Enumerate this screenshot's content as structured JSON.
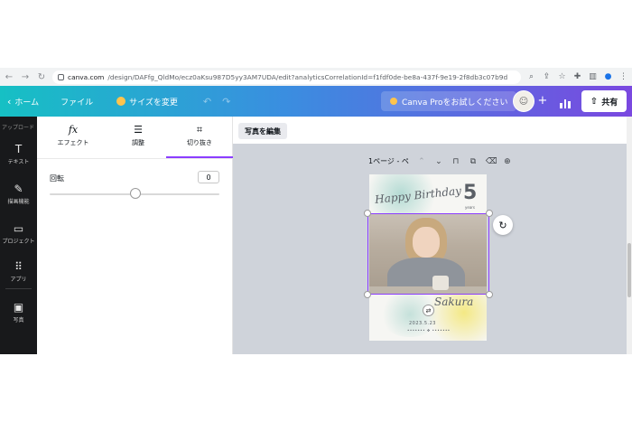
{
  "browser": {
    "url_host": "canva.com",
    "url_path": "/design/DAFfg_QldMo/ecz0aKsu987D5yy3AM7UDA/edit?analyticsCorrelationId=f1fdf0de-be8a-437f-9e19-2f8db3c07b9d"
  },
  "header": {
    "home_label": "ホーム",
    "file_label": "ファイル",
    "resize_label": "サイズを変更",
    "pro_label": "Canva Proをお試しください",
    "share_label": "共有"
  },
  "rail": {
    "top_label": "アップロード",
    "items": [
      {
        "label": "テキスト",
        "icon": "T"
      },
      {
        "label": "描画機能",
        "icon": "✎"
      },
      {
        "label": "プロジェクト",
        "icon": "▭"
      },
      {
        "label": "アプリ",
        "icon": "⠿"
      },
      {
        "label": "写真",
        "icon": "▣"
      }
    ]
  },
  "panel": {
    "tabs": [
      {
        "label": "エフェクト",
        "icon": "fx"
      },
      {
        "label": "調整",
        "icon": "☰"
      },
      {
        "label": "切り抜き",
        "icon": "⌗"
      }
    ],
    "rotation_label": "回転",
    "rotation_value": "0"
  },
  "main": {
    "edit_photo_label": "写真を編集",
    "page_label": "1ページ - ペ"
  },
  "design": {
    "birthday_text": "Happy Birthday",
    "number": "5",
    "years": "years",
    "name_text": "Sakura",
    "date_text": "2023.5.23",
    "dots_text": "••••••• ❖ •••••••"
  },
  "colors": {
    "accent": "#8b3dff",
    "header_start": "#16c0c4",
    "header_end": "#7a48e0"
  }
}
